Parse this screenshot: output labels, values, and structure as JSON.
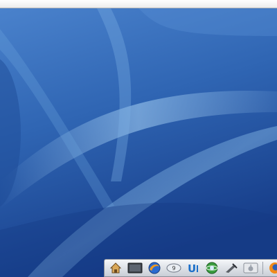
{
  "desktop": {
    "wallpaper_colors": {
      "top": "#3f77c3",
      "mid": "#2f64b2",
      "bottom": "#163f8d",
      "streak": "#9cc8ef"
    }
  },
  "dock": {
    "items": [
      {
        "name": "home",
        "icon": "home-icon"
      },
      {
        "name": "terminal",
        "icon": "terminal-icon"
      },
      {
        "name": "browser",
        "icon": "browser-icon"
      },
      {
        "name": "chat",
        "icon": "chat-icon",
        "badge": "9"
      },
      {
        "name": "media",
        "icon": "media-icon",
        "label": "U"
      },
      {
        "name": "globe",
        "icon": "globe-icon"
      },
      {
        "name": "tool",
        "icon": "tool-icon"
      },
      {
        "name": "apple",
        "icon": "apple-icon"
      },
      {
        "name": "firefox",
        "icon": "firefox-icon"
      }
    ]
  }
}
